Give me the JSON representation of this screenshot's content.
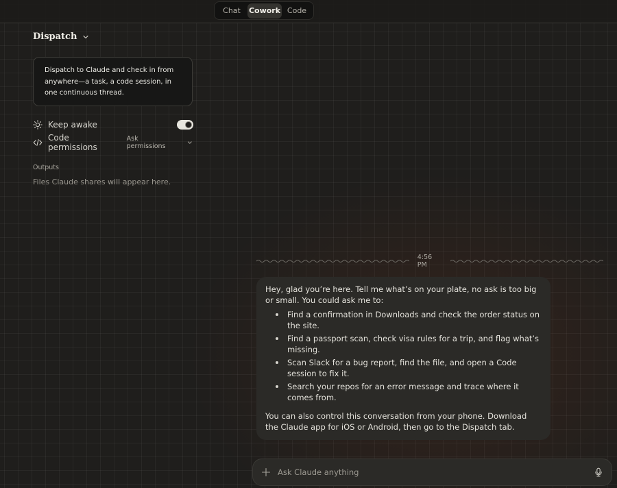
{
  "tabs": [
    {
      "label": "Chat",
      "active": false
    },
    {
      "label": "Cowork",
      "active": true
    },
    {
      "label": "Code",
      "active": false
    }
  ],
  "header": {
    "title": "Dispatch",
    "icon": "chevron-down-icon"
  },
  "info_card": {
    "text": "Dispatch to Claude and check in from anywhere—a task, a code session, in one continuous thread."
  },
  "settings": {
    "keep_awake": {
      "label": "Keep awake",
      "icon": "sun-icon",
      "enabled": true
    },
    "code_permissions": {
      "label": "Code permissions",
      "icon": "code-icon",
      "value": "Ask permissions"
    }
  },
  "outputs": {
    "label": "Outputs",
    "empty_text": "Files Claude shares will appear here."
  },
  "conversation": {
    "timestamp": "4:56 PM",
    "message": {
      "intro": "Hey, glad you’re here. Tell me what’s on your plate, no ask is too big or small. You could ask me to:",
      "items": [
        "Find a confirmation in Downloads and check the order status on the site.",
        "Find a passport scan, check visa rules for a trip, and flag what’s missing.",
        "Scan Slack for a bug report, find the file, and open a Code session to fix it.",
        "Search your repos for an error message and trace where it comes from."
      ],
      "outro": "You can also control this conversation from your phone. Download the Claude app for iOS or Android, then go to the Dispatch tab."
    }
  },
  "composer": {
    "placeholder": "Ask Claude anything",
    "value": "",
    "icons": [
      "plus-icon",
      "microphone-icon"
    ]
  },
  "colors": {
    "background": "#1f1e1c",
    "bubble": "#2b2a27",
    "text": "#e8e6df",
    "muted": "#9d9a92"
  }
}
